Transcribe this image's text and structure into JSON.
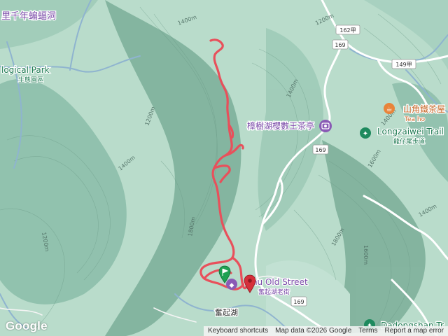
{
  "map": {
    "labels": {
      "bat_cave": "里千年蝙蝠洞",
      "ecological_park": "logical Park",
      "ecological_park_zh": "生態園區",
      "tea_house": "樟樹湖櫻數王茶亭",
      "shanjiao_tea": "山角鐵茶屋",
      "tea_house_en": "Tea ho",
      "longzaiwei_trail": "Longzaiwei Trail",
      "longzaiwei_trail_zh": "龍仔尾步道",
      "old_street": "qihu Old Street",
      "old_street_zh": "奮起湖老街",
      "fenqihu": "奮起湖",
      "dadongshan": "Dadongshan Tr"
    },
    "roads": [
      "162甲",
      "169",
      "149甲",
      "169",
      "169"
    ],
    "contours": [
      "1400m",
      "1200m",
      "1200m",
      "1400m",
      "1400m",
      "1200m",
      "1800m",
      "1600m",
      "1800m",
      "1600m",
      "1400m",
      "1400m"
    ],
    "colors": {
      "terrain_light": "#cfe8dc",
      "terrain_dark": "#6fa390",
      "track": "#e8505b",
      "road": "#ffffff",
      "river": "#8fb4cf",
      "poi_purple": "#8a5ab5",
      "poi_orange": "#e8843a",
      "poi_green": "#1e8a5e",
      "start_marker": "#1ea152",
      "end_marker": "#d5303a"
    }
  },
  "footer": {
    "logo": "Google",
    "keyboard": "Keyboard shortcuts",
    "mapdata": "Map data ©2026 Google",
    "terms": "Terms",
    "report": "Report a map error"
  }
}
